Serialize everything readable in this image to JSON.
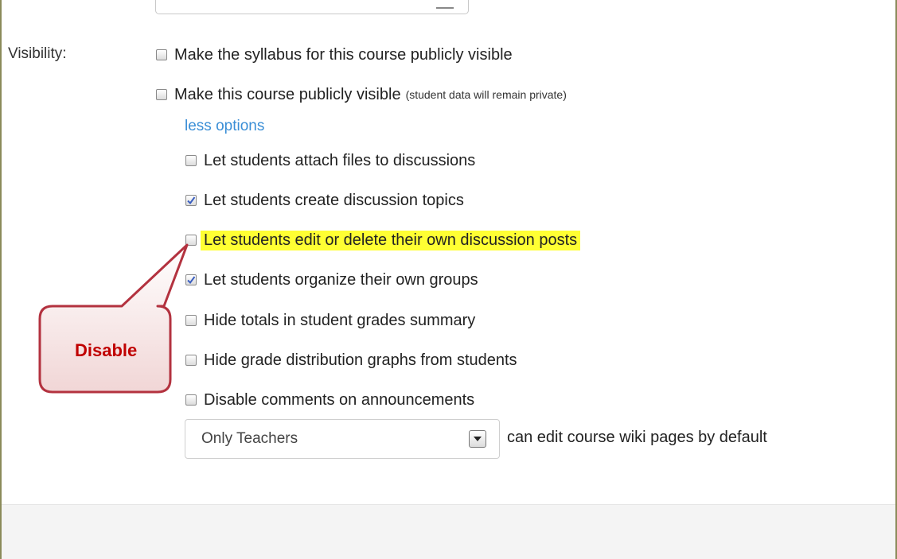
{
  "visibility": {
    "label": "Visibility:",
    "options": [
      {
        "label": "Make the syllabus for this course publicly visible",
        "checked": false
      },
      {
        "label": "Make this course publicly visible",
        "note": "(student data will remain private)",
        "checked": false
      }
    ],
    "toggle_link": "less options"
  },
  "more_options": [
    {
      "label": "Let students attach files to discussions",
      "checked": false
    },
    {
      "label": "Let students create discussion topics",
      "checked": true
    },
    {
      "label": "Let students edit or delete their own discussion posts",
      "checked": false,
      "highlighted": true
    },
    {
      "label": "Let students organize their own groups",
      "checked": true
    },
    {
      "label": "Hide totals in student grades summary",
      "checked": false
    },
    {
      "label": "Hide grade distribution graphs from students",
      "checked": false
    },
    {
      "label": "Disable comments on announcements",
      "checked": false
    }
  ],
  "wiki_permission": {
    "selected": "Only Teachers",
    "caption": "can edit course wiki pages by default"
  },
  "callout": {
    "text": "Disable",
    "color": "#c00000"
  },
  "colors": {
    "link": "#3a8ed6",
    "highlight": "#ffff33",
    "checkmark": "#3b5fc0",
    "frame": "#8b8b5a"
  }
}
